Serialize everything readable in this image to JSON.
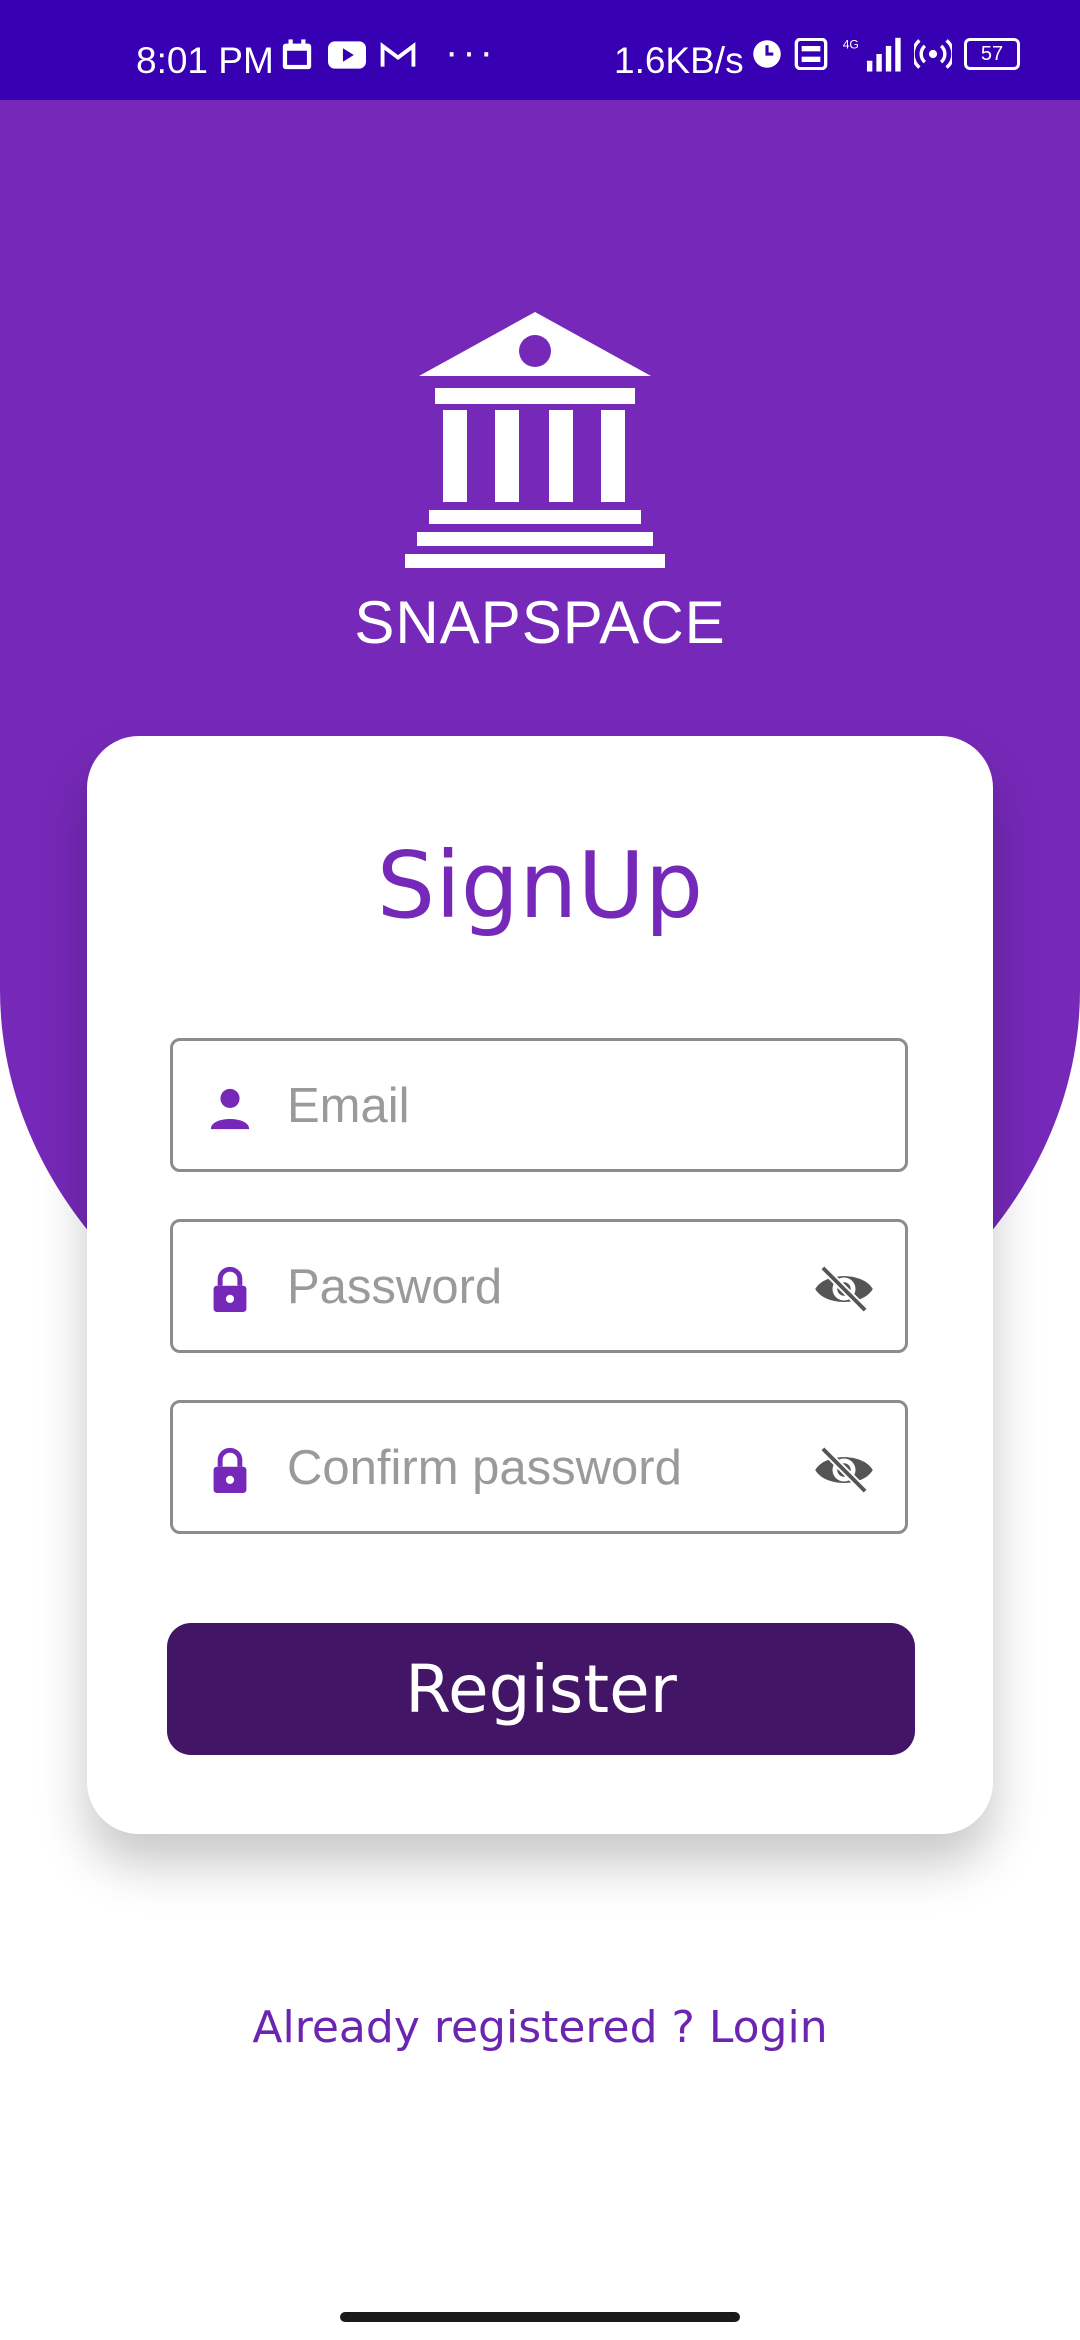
{
  "status_bar": {
    "time": "8:01 PM",
    "dots": "···",
    "network_speed": "1.6KB/s",
    "battery": "57",
    "icons_left": [
      "calendar-icon",
      "youtube-icon",
      "gmail-icon"
    ],
    "icons_right": [
      "clock-icon",
      "volte-icon",
      "4g-signal-icon",
      "hotspot-icon",
      "battery-icon"
    ]
  },
  "brand": {
    "name": "SNAPSPACE",
    "logo_icon": "bank-building-icon"
  },
  "form": {
    "title": "SignUp",
    "email_placeholder": "Email",
    "password_placeholder": "Password",
    "confirm_placeholder": "Confirm password",
    "register_label": "Register"
  },
  "footer": {
    "login_link": "Already registered ? Login"
  },
  "colors": {
    "status_bar": "#3700B3",
    "primary": "#7629B8",
    "button": "#421566",
    "link": "#6B25B0"
  }
}
